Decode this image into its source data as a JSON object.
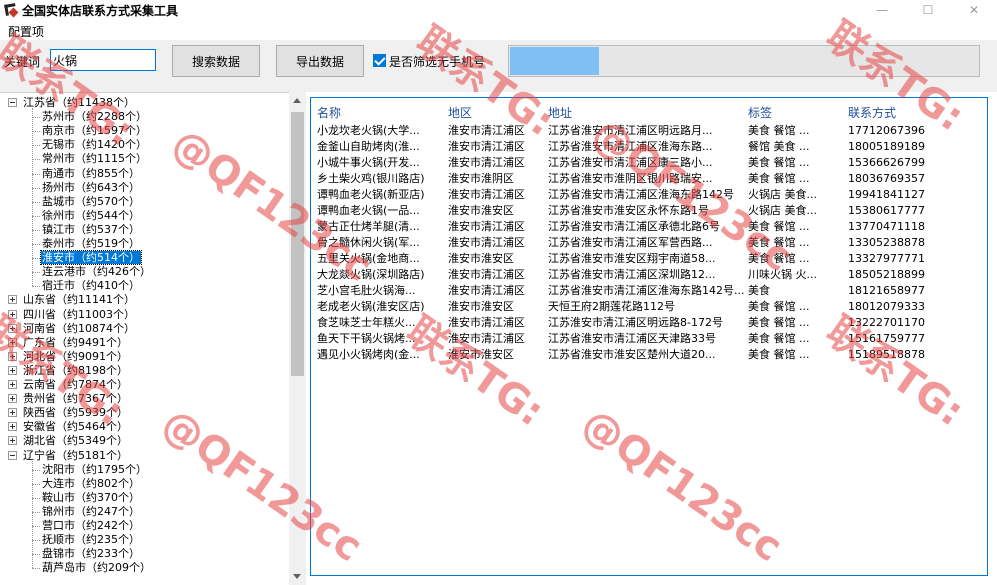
{
  "window": {
    "title": "全国实体店联系方式采集工具",
    "minimize": "—",
    "maximize": "☐",
    "close": "✕"
  },
  "menu": {
    "config": "配置项"
  },
  "toolbar": {
    "keyword_label": "关键词",
    "keyword_value": "火锅",
    "search_button": "搜索数据",
    "export_button": "导出数据",
    "filter_label": "是否筛选无手机号",
    "filter_checked": true,
    "progress_percent": 19
  },
  "tree": [
    {
      "label": "江苏省（约11438个）",
      "level": 0,
      "expanded": true
    },
    {
      "label": "苏州市（约2288个）",
      "level": 1
    },
    {
      "label": "南京市（约1597个）",
      "level": 1
    },
    {
      "label": "无锡市（约1420个）",
      "level": 1
    },
    {
      "label": "常州市（约1115个）",
      "level": 1
    },
    {
      "label": "南通市（约855个）",
      "level": 1
    },
    {
      "label": "扬州市（约643个）",
      "level": 1
    },
    {
      "label": "盐城市（约570个）",
      "level": 1
    },
    {
      "label": "徐州市（约544个）",
      "level": 1
    },
    {
      "label": "镇江市（约537个）",
      "level": 1
    },
    {
      "label": "泰州市（约519个）",
      "level": 1
    },
    {
      "label": "淮安市（约514个）",
      "level": 1,
      "selected": true
    },
    {
      "label": "连云港市（约426个）",
      "level": 1
    },
    {
      "label": "宿迁市（约410个）",
      "level": 1
    },
    {
      "label": "山东省（约11141个）",
      "level": 0
    },
    {
      "label": "四川省（约11003个）",
      "level": 0
    },
    {
      "label": "河南省（约10874个）",
      "level": 0
    },
    {
      "label": "广东省（约9491个）",
      "level": 0
    },
    {
      "label": "河北省（约9091个）",
      "level": 0
    },
    {
      "label": "浙江省（约8198个）",
      "level": 0
    },
    {
      "label": "云南省（约7874个）",
      "level": 0
    },
    {
      "label": "贵州省（约7367个）",
      "level": 0
    },
    {
      "label": "陕西省（约5939个）",
      "level": 0
    },
    {
      "label": "安徽省（约5464个）",
      "level": 0
    },
    {
      "label": "湖北省（约5349个）",
      "level": 0
    },
    {
      "label": "辽宁省（约5181个）",
      "level": 0,
      "expanded": true
    },
    {
      "label": "沈阳市（约1795个）",
      "level": 1
    },
    {
      "label": "大连市（约802个）",
      "level": 1
    },
    {
      "label": "鞍山市（约370个）",
      "level": 1
    },
    {
      "label": "锦州市（约247个）",
      "level": 1
    },
    {
      "label": "营口市（约242个）",
      "level": 1
    },
    {
      "label": "抚顺市（约235个）",
      "level": 1
    },
    {
      "label": "盘锦市（约233个）",
      "level": 1
    },
    {
      "label": "葫芦岛市（约209个）",
      "level": 1
    }
  ],
  "list": {
    "columns": [
      "名称",
      "地区",
      "地址",
      "标签",
      "联系方式"
    ],
    "rows": [
      [
        "小龙坎老火锅(大学...",
        "淮安市清江浦区",
        "江苏省淮安市清江浦区明远路月...",
        "美食 餐馆 ...",
        "17712067396"
      ],
      [
        "金釜山自助烤肉(淮...",
        "淮安市清江浦区",
        "江苏省淮安市清江浦区淮海东路...",
        "餐馆 美食 ...",
        "18005189189"
      ],
      [
        "小城牛事火锅(开发...",
        "淮安市清江浦区",
        "江苏省淮安市清江浦区康三路小...",
        "美食 餐馆 ...",
        "15366626799"
      ],
      [
        "乡土柴火鸡(银川路店)",
        "淮安市淮阴区",
        "江苏省淮安市淮阴区银川路瑞安...",
        "美食 餐馆 ...",
        "18036769357"
      ],
      [
        "谭鸭血老火锅(新亚店)",
        "淮安市清江浦区",
        "江苏省淮安市清江浦区淮海东路142号",
        "火锅店 美食...",
        "19941841127"
      ],
      [
        "谭鸭血老火锅(一品...",
        "淮安市淮安区",
        "江苏省淮安市淮安区永怀东路1号",
        "火锅店 美食...",
        "15380617777"
      ],
      [
        "蒙古正仕烤羊腿(清...",
        "淮安市清江浦区",
        "江苏省淮安市清江浦区承德北路6号",
        "美食 餐馆 ...",
        "13770471118"
      ],
      [
        "骨之髓休闲火锅(军...",
        "淮安市清江浦区",
        "江苏省淮安市清江浦区军营西路...",
        "美食 餐馆 ...",
        "13305238878"
      ],
      [
        "五里关火锅(金地商...",
        "淮安市淮安区",
        "江苏省淮安市淮安区翔宇南道58...",
        "美食 餐馆 ...",
        "13327977771"
      ],
      [
        "大龙燚火锅(深圳路店)",
        "淮安市清江浦区",
        "江苏省淮安市清江浦区深圳路12...",
        "川味火锅 火...",
        "18505218899"
      ],
      [
        "芝小宫毛肚火锅海...",
        "淮安市清江浦区",
        "江苏省淮安市清江浦区淮海东路142号...",
        "美食",
        "18121658977"
      ],
      [
        "老成老火锅(淮安区店)",
        "淮安市淮安区",
        "天恒王府2期莲花路112号",
        "美食 餐馆 ...",
        "18012079333"
      ],
      [
        "食芝味芝士年糕火...",
        "淮安市清江浦区",
        "江苏淮安市清江浦区明远路8-172号",
        "美食 餐馆 ...",
        "13222701170"
      ],
      [
        "鱼天下干锅火锅烤...",
        "淮安市清江浦区",
        "江苏省淮安市清江浦区天津路33号",
        "美食 餐馆 ...",
        "15161759777"
      ],
      [
        "遇见小火锅烤肉(金...",
        "淮安市淮安区",
        "江苏省淮安市淮安区楚州大道20...",
        "美食 餐馆 ...",
        "15189518878"
      ]
    ]
  },
  "watermark": {
    "line1": "联系TG:",
    "line2": "@QF123cc"
  }
}
